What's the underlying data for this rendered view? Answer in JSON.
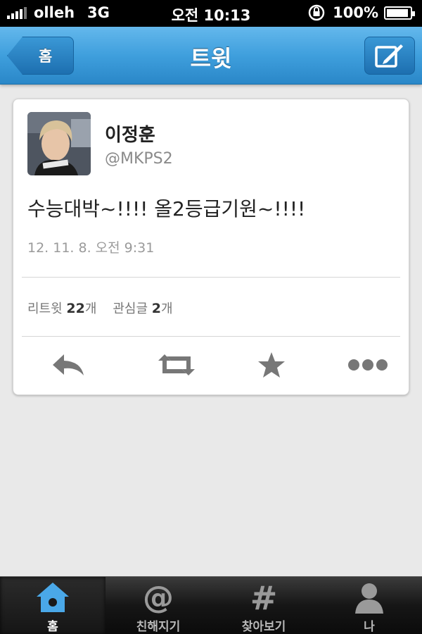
{
  "status_bar": {
    "carrier": "olleh",
    "network": "3G",
    "time": "오전 10:13",
    "battery": "100%"
  },
  "nav": {
    "back_label": "홈",
    "title": "트윗",
    "compose_icon": "compose-quill-icon"
  },
  "tweet": {
    "name": "이정훈",
    "handle": "@MKPS2",
    "text": "수능대박~!!!! 올2등급기원~!!!!",
    "timestamp": "12. 11. 8. 오전 9:31",
    "retweet_label": "리트윗",
    "retweet_count": "22",
    "retweet_unit": "개",
    "favorite_label": "관심글",
    "favorite_count": "2",
    "favorite_unit": "개"
  },
  "actions": [
    "reply-icon",
    "retweet-icon",
    "favorite-star-icon",
    "more-icon"
  ],
  "tabs": [
    {
      "label": "홈",
      "icon": "home-icon",
      "active": true
    },
    {
      "label": "친해지기",
      "icon": "at-icon",
      "active": false
    },
    {
      "label": "찾아보기",
      "icon": "hash-icon",
      "active": false
    },
    {
      "label": "나",
      "icon": "person-icon",
      "active": false
    }
  ],
  "colors": {
    "nav_blue": "#3f9fdd",
    "tab_active_blue": "#4aa8e8",
    "text_gray": "#8a8a8a"
  }
}
